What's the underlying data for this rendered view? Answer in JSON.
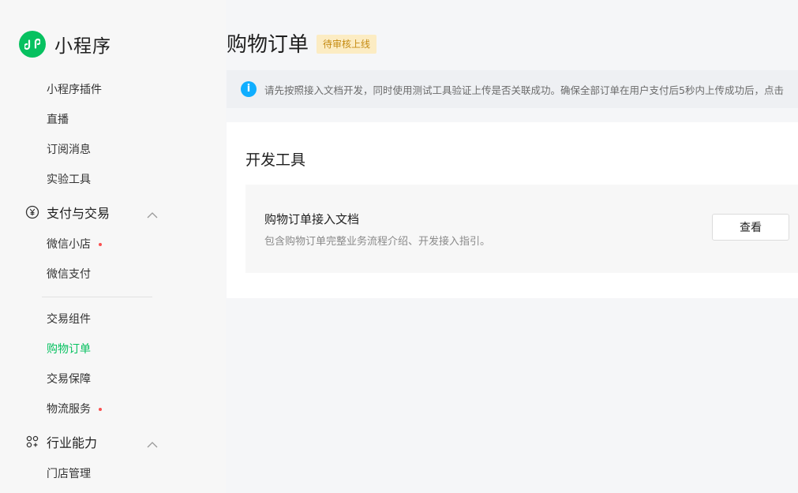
{
  "brand": {
    "name": "小程序",
    "icon": "mini-program-logo-icon"
  },
  "sidebar": {
    "items_top": [
      {
        "label": "小程序插件"
      },
      {
        "label": "直播"
      },
      {
        "label": "订阅消息"
      },
      {
        "label": "实验工具"
      }
    ],
    "group_payment": {
      "label": "支付与交易",
      "icon": "yuan-circle-icon"
    },
    "items_payment": [
      {
        "label": "微信小店",
        "dot": true
      },
      {
        "label": "微信支付"
      }
    ],
    "items_trade": [
      {
        "label": "交易组件"
      },
      {
        "label": "购物订单",
        "active": true
      },
      {
        "label": "交易保障"
      },
      {
        "label": "物流服务",
        "dot": true
      }
    ],
    "group_industry": {
      "label": "行业能力",
      "icon": "industry-nodes-icon"
    },
    "items_industry": [
      {
        "label": "门店管理"
      }
    ]
  },
  "header": {
    "title": "购物订单",
    "badge": "待审核上线"
  },
  "notice": {
    "text": "请先按照接入文档开发，同时使用测试工具验证上传是否关联成功。确保全部订单在用户支付后5秒内上传成功后，点击"
  },
  "dev_tools": {
    "title": "开发工具",
    "doc_card": {
      "title": "购物订单接入文档",
      "desc": "包含购物订单完整业务流程介绍、开发接入指引。",
      "button": "查看"
    }
  },
  "colors": {
    "accent": "#07c160",
    "badge_bg": "#fcecc3",
    "badge_text": "#c58b12",
    "info": "#10aeff",
    "dot": "#fa5151"
  }
}
